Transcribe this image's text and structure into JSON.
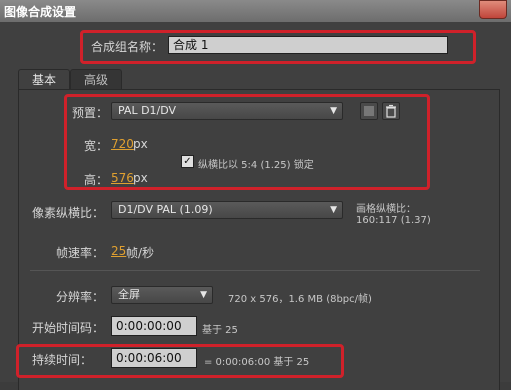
{
  "window": {
    "title": "图像合成设置"
  },
  "comp_name": {
    "label": "合成组名称：",
    "value": "合成 1"
  },
  "tabs": [
    {
      "label": "基本"
    },
    {
      "label": "高级"
    }
  ],
  "preset": {
    "label": "预置：",
    "value": "PAL D1/DV"
  },
  "width": {
    "label": "宽：",
    "value": "720",
    "unit": "px"
  },
  "height": {
    "label": "高：",
    "value": "576",
    "unit": "px"
  },
  "aspect_lock": {
    "checked": true,
    "label": "纵横比以 5:4 (1.25) 锁定"
  },
  "pixel_aspect": {
    "label": "像素纵横比：",
    "value": "D1/DV PAL (1.09)",
    "frame_aspect_label": "画格纵横比：",
    "frame_aspect_value": "160:117 (1.37)"
  },
  "frame_rate": {
    "label": "帧速率：",
    "value": "25",
    "unit": "帧/秒"
  },
  "resolution": {
    "label": "分辨率：",
    "value": "全屏",
    "info": "720 x 576，1.6 MB (8bpc/帧)"
  },
  "start_timecode": {
    "label": "开始时间码：",
    "value": "0:00:00:00",
    "note": "基于 25"
  },
  "duration": {
    "label": "持续时间：",
    "value": "0:00:06:00",
    "note": "= 0:00:06:00  基于 25"
  },
  "colors": {
    "highlight": "#d0212a",
    "accent": "#e0a030"
  }
}
